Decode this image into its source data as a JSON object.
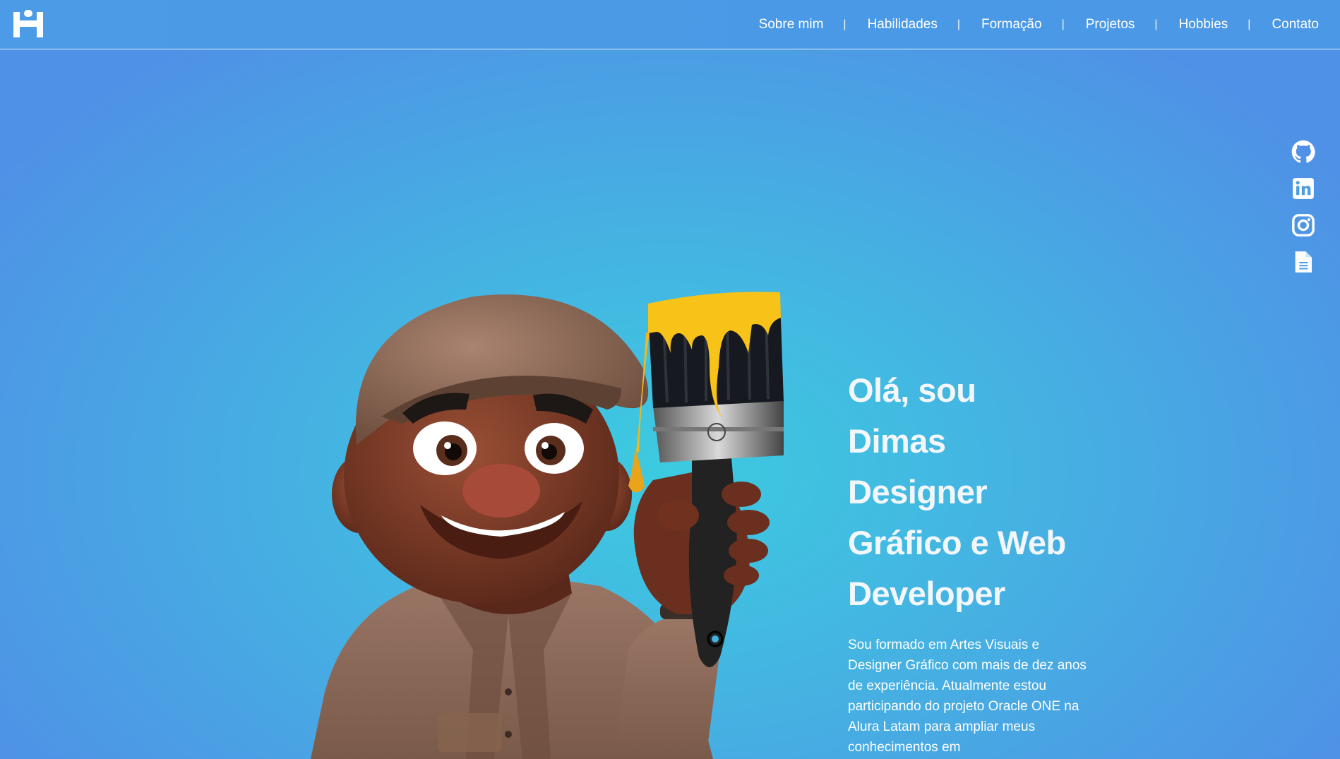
{
  "header": {
    "logo_icon": "dimas-logo-icon",
    "nav": [
      {
        "label": "Sobre mim"
      },
      {
        "label": "Habilidades"
      },
      {
        "label": "Formação"
      },
      {
        "label": "Projetos"
      },
      {
        "label": "Hobbies"
      },
      {
        "label": "Contato"
      }
    ],
    "separator": "|"
  },
  "social": [
    {
      "icon": "github-icon"
    },
    {
      "icon": "linkedin-icon"
    },
    {
      "icon": "instagram-icon"
    },
    {
      "icon": "document-icon"
    }
  ],
  "hero": {
    "title_lines": [
      "Olá, sou",
      "Dimas",
      "Designer",
      "Gráfico e Web",
      "Developer"
    ],
    "description": "Sou formado em Artes Visuais e Designer Gráfico com mais de dez anos de experiência. Atualmente estou participando do projeto Oracle ONE na Alura Latam para ampliar meus conhecimentos em"
  },
  "colors": {
    "background_center": "#3ccbe0",
    "background_edge": "#4f91e6",
    "header": "#4b9be6",
    "paint_yellow": "#f7c319"
  }
}
